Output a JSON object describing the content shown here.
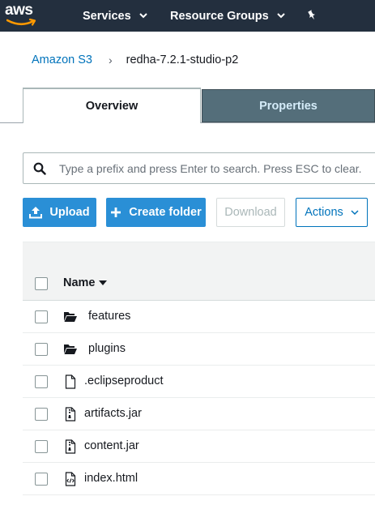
{
  "topnav": {
    "logo_text": "aws",
    "services_label": "Services",
    "resource_groups_label": "Resource Groups",
    "icons": {
      "services_chevron": "chevron-down-icon",
      "resource_groups_chevron": "chevron-down-icon",
      "pin": "pushpin-icon"
    }
  },
  "breadcrumb": {
    "root": "Amazon S3",
    "separator": "›",
    "current": "redha-7.2.1-studio-p2"
  },
  "tabs": [
    {
      "label": "Overview",
      "active": true
    },
    {
      "label": "Properties",
      "active": false
    }
  ],
  "search": {
    "placeholder": "Type a prefix and press Enter to search. Press ESC to clear.",
    "value": ""
  },
  "toolbar": {
    "upload_label": "Upload",
    "create_folder_label": "Create folder",
    "download_label": "Download",
    "actions_label": "Actions"
  },
  "table": {
    "name_header": "Name",
    "rows": [
      {
        "name": "features",
        "type": "folder"
      },
      {
        "name": "plugins",
        "type": "folder"
      },
      {
        "name": ".eclipseproduct",
        "type": "file"
      },
      {
        "name": "artifacts.jar",
        "type": "archive"
      },
      {
        "name": "content.jar",
        "type": "archive"
      },
      {
        "name": "index.html",
        "type": "code"
      }
    ]
  },
  "colors": {
    "nav_bg": "#232f3e",
    "primary_button": "#2a8fd6",
    "link": "#0073bb",
    "properties_tab_bg": "#546e7a",
    "aws_smile": "#ff9900"
  }
}
